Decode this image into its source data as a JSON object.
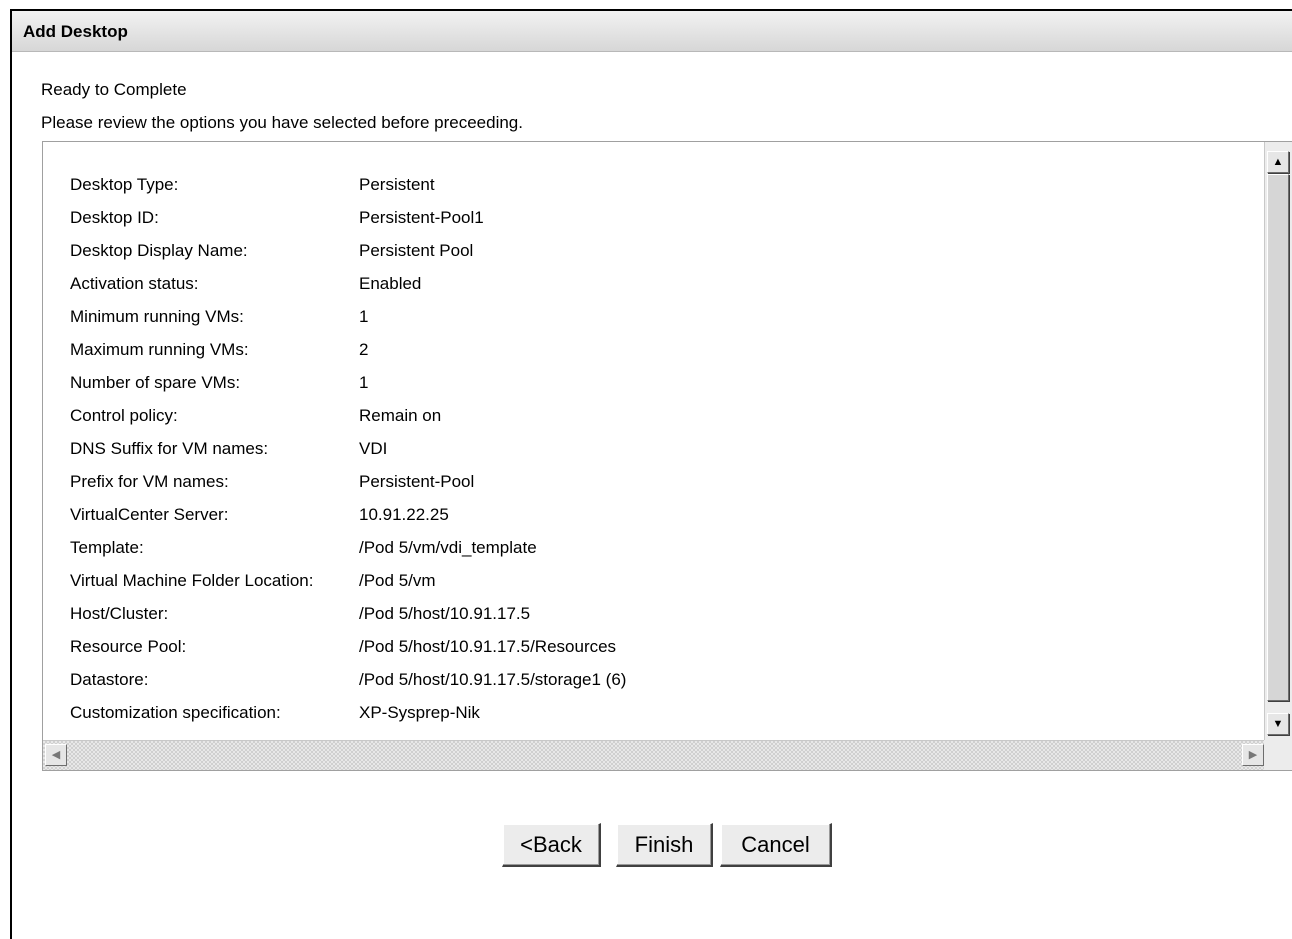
{
  "window": {
    "title": "Add Desktop"
  },
  "step": {
    "heading": "Ready to Complete",
    "instructions": "Please review the options you have selected before preceeding."
  },
  "summary": [
    {
      "label": "Desktop Type:",
      "value": "Persistent"
    },
    {
      "label": "Desktop ID:",
      "value": "Persistent-Pool1"
    },
    {
      "label": "Desktop Display Name:",
      "value": "Persistent Pool"
    },
    {
      "label": "Activation status:",
      "value": "Enabled"
    },
    {
      "label": "Minimum running VMs:",
      "value": "1"
    },
    {
      "label": "Maximum running VMs:",
      "value": "2"
    },
    {
      "label": "Number of spare VMs:",
      "value": "1"
    },
    {
      "label": "Control policy:",
      "value": "Remain on"
    },
    {
      "label": "DNS Suffix for VM names:",
      "value": "VDI"
    },
    {
      "label": "Prefix for VM names:",
      "value": "Persistent-Pool"
    },
    {
      "label": "VirtualCenter Server:",
      "value": "10.91.22.25"
    },
    {
      "label": "Template:",
      "value": "/Pod 5/vm/vdi_template"
    },
    {
      "label": "Virtual Machine Folder Location:",
      "value": "/Pod 5/vm"
    },
    {
      "label": "Host/Cluster:",
      "value": "/Pod 5/host/10.91.17.5"
    },
    {
      "label": "Resource Pool:",
      "value": "/Pod 5/host/10.91.17.5/Resources"
    },
    {
      "label": "Datastore:",
      "value": "/Pod 5/host/10.91.17.5/storage1 (6)"
    },
    {
      "label": "Customization specification:",
      "value": "XP-Sysprep-Nik"
    }
  ],
  "scrollbar_icons": {
    "up": "up-arrow-icon",
    "down": "down-arrow-icon",
    "left": "left-arrow-icon",
    "right": "right-arrow-icon"
  },
  "buttons": {
    "back": "<Back",
    "finish": "Finish",
    "cancel": "Cancel"
  }
}
